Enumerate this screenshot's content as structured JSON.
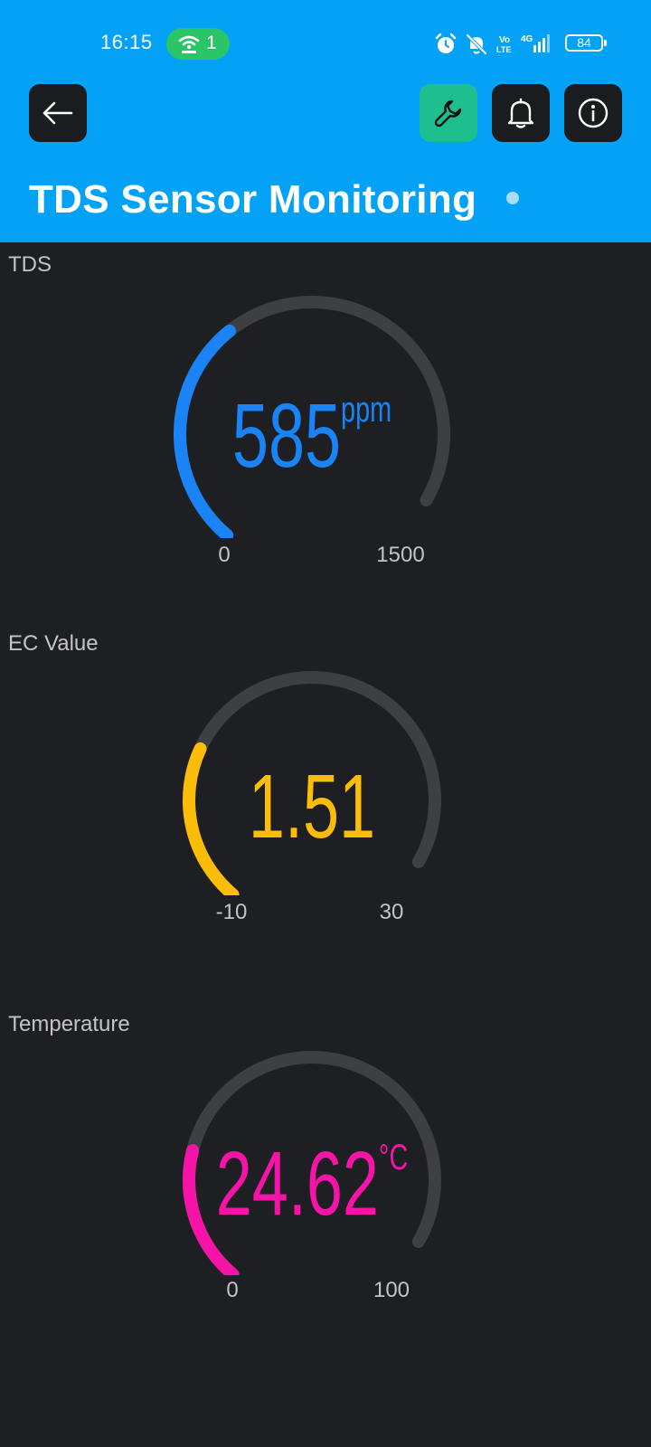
{
  "status_bar": {
    "time": "16:15",
    "hotspot_count": "1",
    "hotspot_color": "#2bc466",
    "icons": [
      "alarm-icon",
      "bell-off-icon",
      "volte-icon",
      "4g-signal-icon"
    ],
    "volte_text": "Vo\nLTE",
    "network_text": "4G",
    "battery": "84"
  },
  "header": {
    "background": "#03a2f7",
    "title": "TDS Sensor Monitoring",
    "buttons": {
      "back": "back-arrow-icon",
      "settings": "wrench-icon",
      "notifications": "bell-icon",
      "info": "info-icon"
    }
  },
  "gauges": [
    {
      "label": "TDS",
      "value": "585",
      "unit": "ppm",
      "min": "0",
      "max": "1500",
      "numeric_value": 585,
      "numeric_min": 0,
      "numeric_max": 1500,
      "color": "#1a83f6"
    },
    {
      "label": "EC Value",
      "value": "1.51",
      "unit": "",
      "min": "-10",
      "max": "30",
      "numeric_value": 1.51,
      "numeric_min": -10,
      "numeric_max": 30,
      "color": "#fbbd08"
    },
    {
      "label": "Temperature",
      "value": "24.62",
      "unit": "°C",
      "min": "0",
      "max": "100",
      "numeric_value": 24.62,
      "numeric_min": 0,
      "numeric_max": 100,
      "color": "#f614a8"
    }
  ]
}
